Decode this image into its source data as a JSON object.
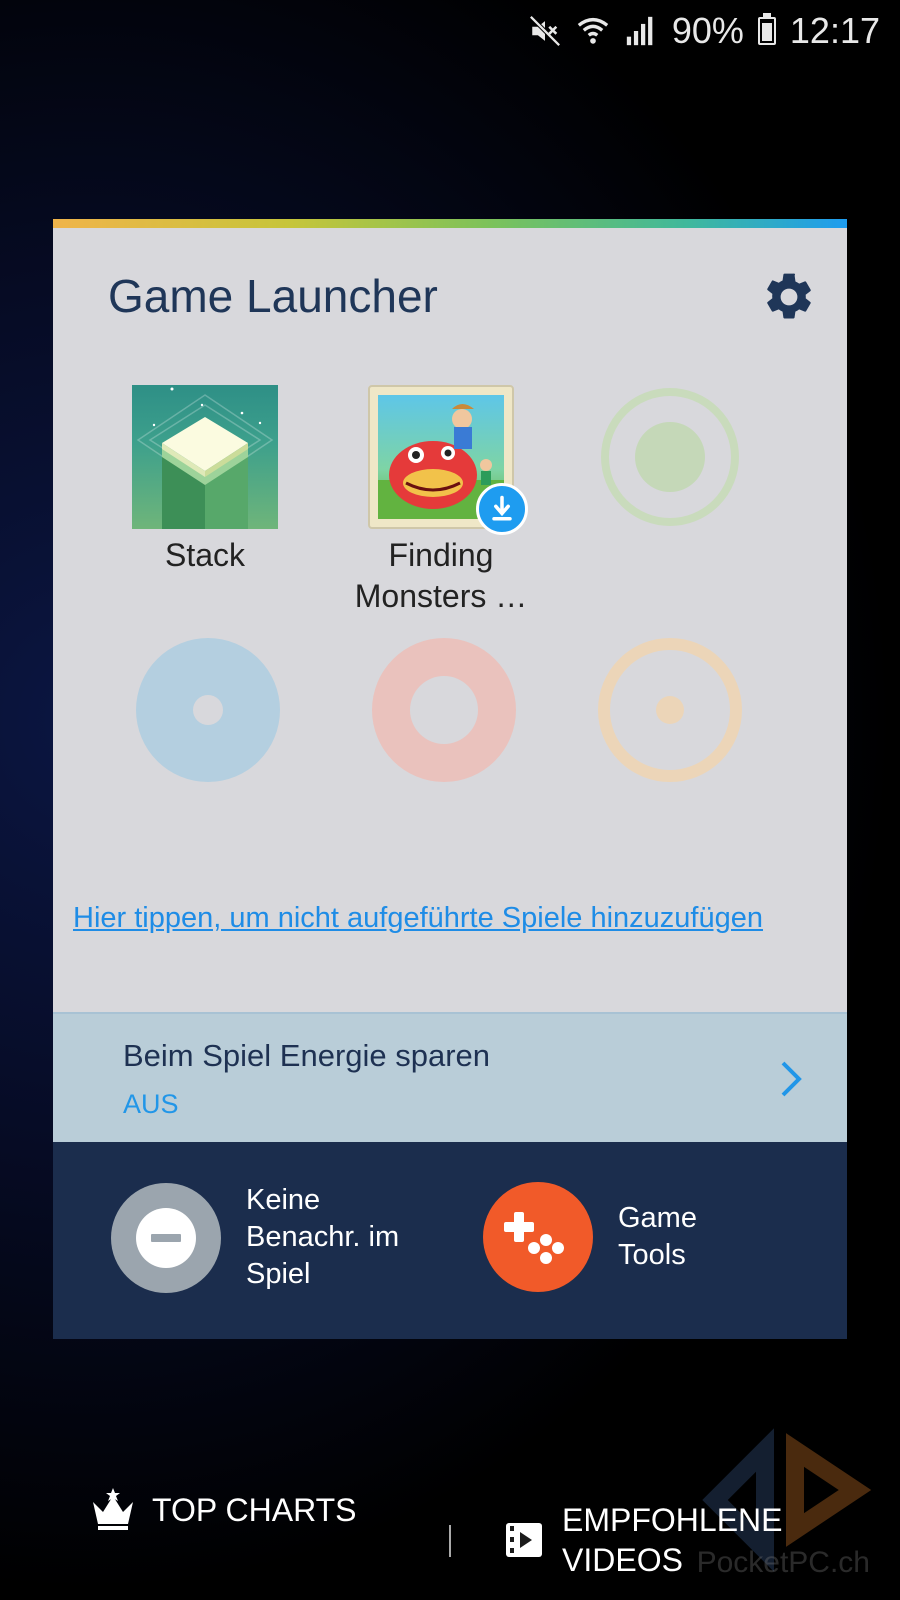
{
  "status_bar": {
    "battery": "90%",
    "time": "12:17",
    "icons": [
      "mute-icon",
      "wifi-icon",
      "signal-icon",
      "battery-icon"
    ]
  },
  "launcher": {
    "title": "Game Launcher",
    "games": [
      {
        "label": "Stack",
        "icon": "stack-game-icon"
      },
      {
        "label": "Finding\nMonsters …",
        "icon": "finding-monsters-icon",
        "badge": "download-icon"
      }
    ],
    "add_link": "Hier tippen, um nicht aufgeführte Spiele hinzuzufügen",
    "power_saving": {
      "title": "Beim Spiel Energie sparen",
      "value": "AUS"
    },
    "quick_actions": {
      "no_alerts": {
        "label": "Keine Benachr. im Spiel",
        "icon": "minus-circle-icon"
      },
      "game_tools": {
        "label": "Game Tools",
        "icon": "gamepad-icon"
      }
    }
  },
  "bottom_nav": {
    "top_charts": "TOP CHARTS",
    "recommended_videos": "EMPFOHLENE VIDEOS"
  },
  "watermark": "PocketPC.ch",
  "colors": {
    "accent_blue": "#1e9cf0",
    "title_navy": "#1f3658",
    "panel_navy": "#1b2d4d",
    "game_tools_orange": "#f15a29",
    "placeholder_green": "#c5d8b8",
    "placeholder_blue": "#b4cfe0",
    "placeholder_red": "#eac2bd",
    "placeholder_orange": "#ecd5b8"
  }
}
